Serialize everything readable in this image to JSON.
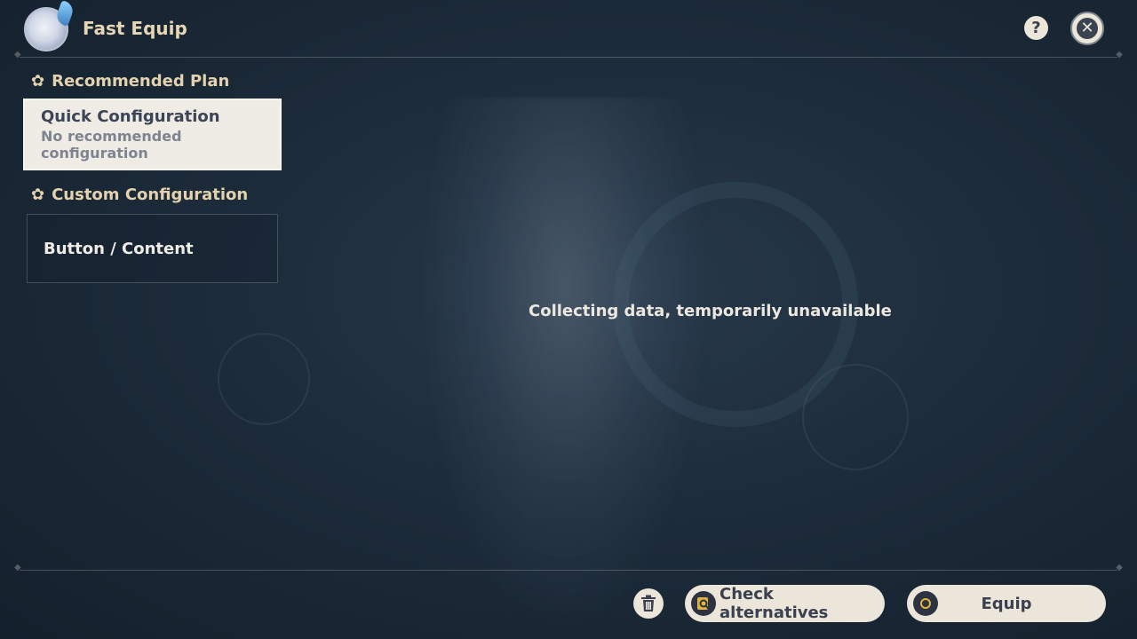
{
  "header": {
    "title": "Fast Equip",
    "help_label": "?",
    "close_label": "✕"
  },
  "recommended": {
    "heading": "Recommended Plan",
    "card_title": "Quick Configuration",
    "card_subtitle_line1": "No recommended",
    "card_subtitle_line2": "configuration"
  },
  "custom": {
    "heading": "Custom Configuration",
    "card_label": "Button / Content"
  },
  "main": {
    "status": "Collecting data, temporarily unavailable"
  },
  "footer": {
    "check_label": "Check alternatives",
    "equip_label": "Equip"
  },
  "icons": {
    "heading": "flower-icon",
    "trash": "trash-icon",
    "check": "search-icon",
    "equip": "confirm-ring-icon"
  },
  "colors": {
    "accent_gold": "#e3d2ad",
    "button_bg": "#ece6da",
    "ring": "#e3b340"
  }
}
